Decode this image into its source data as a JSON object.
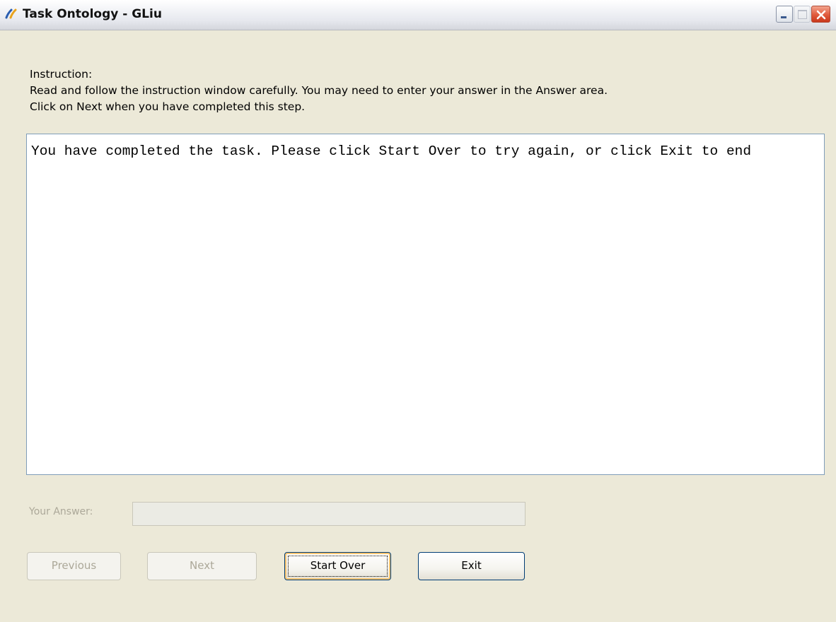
{
  "window": {
    "title": "Task Ontology - GLiu",
    "app_icon": "double-slash-logo-icon",
    "controls": {
      "minimize_icon": "minimize-icon",
      "maximize_icon": "maximize-icon",
      "close_icon": "close-icon"
    }
  },
  "instruction": {
    "heading": "Instruction:",
    "line1": "Read and follow the instruction window carefully. You may need to enter your answer in the Answer area.",
    "line2": "Click on Next when you have completed this step."
  },
  "content": {
    "text": "You have completed the task. Please click Start Over to try again, or click Exit to end"
  },
  "answer": {
    "label": "Your Answer:",
    "value": ""
  },
  "buttons": {
    "previous": "Previous",
    "next": "Next",
    "start_over": "Start Over",
    "exit": "Exit"
  },
  "colors": {
    "window_bg": "#ece9d8",
    "disabled_text": "#aca899",
    "close_button": "#e05a3c",
    "focus_highlight": "#f7c572",
    "button_border": "#003c74"
  }
}
